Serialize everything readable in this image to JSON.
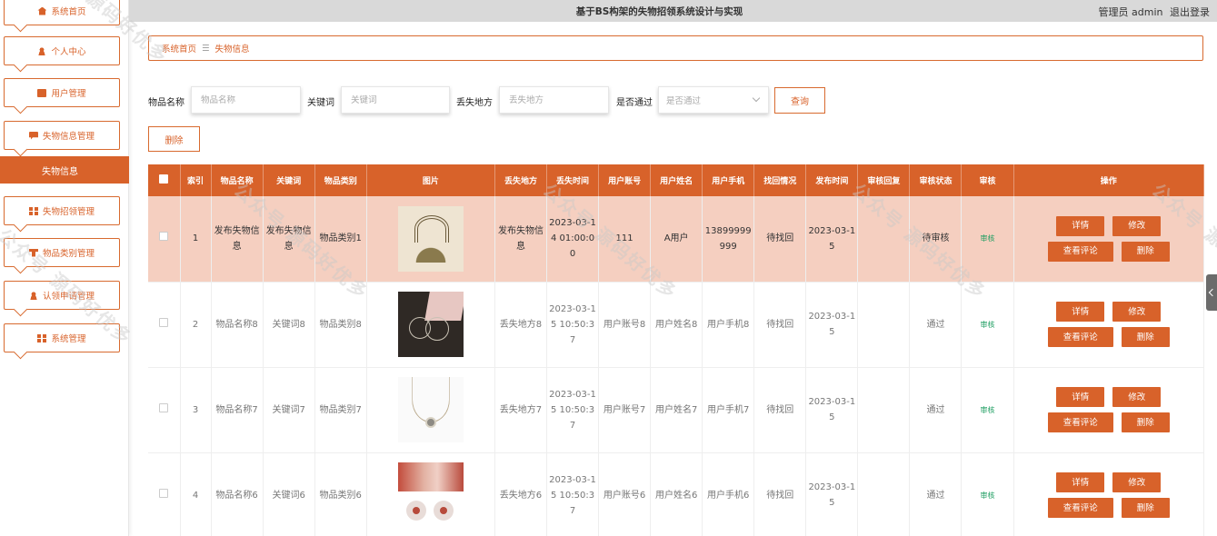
{
  "app": {
    "title": "基于BS构架的失物招领系统设计与实现",
    "user_label": "管理员 admin",
    "logout": "退出登录"
  },
  "sidebar": {
    "items": [
      {
        "label": "系统首页",
        "icon": "home-icon"
      },
      {
        "label": "个人中心",
        "icon": "user-icon"
      },
      {
        "label": "用户管理",
        "icon": "briefcase-icon"
      },
      {
        "label": "失物信息管理",
        "icon": "message-icon"
      },
      {
        "label": "失物招领管理",
        "icon": "grid-icon"
      },
      {
        "label": "物品类别管理",
        "icon": "shop-icon"
      },
      {
        "label": "认领申请管理",
        "icon": "user-icon"
      },
      {
        "label": "系统管理",
        "icon": "grid-icon"
      }
    ],
    "active_sub": "失物信息"
  },
  "breadcrumb": {
    "home": "系统首页",
    "sep": "☰",
    "current": "失物信息"
  },
  "search": {
    "name_label": "物品名称",
    "name_placeholder": "物品名称",
    "keyword_label": "关键词",
    "keyword_placeholder": "关键词",
    "place_label": "丢失地方",
    "place_placeholder": "丢失地方",
    "passed_label": "是否通过",
    "passed_placeholder": "是否通过",
    "query_btn": "查询",
    "delete_btn": "删除"
  },
  "table": {
    "headers": [
      "索引",
      "物品名称",
      "关键词",
      "物品类别",
      "图片",
      "丢失地方",
      "丢失时间",
      "用户账号",
      "用户姓名",
      "用户手机",
      "找回情况",
      "发布时间",
      "审核回复",
      "审核状态",
      "审核",
      "操作"
    ],
    "rows": [
      {
        "index": "1",
        "name": "发布失物信息",
        "keyword": "发布失物信息",
        "category": "物品类别1",
        "image": "book",
        "place": "发布失物信息",
        "time": "2023-03-14 01:00:00",
        "account": "111",
        "username": "A用户",
        "phone": "13899999999",
        "found": "待找回",
        "publish": "2023-03-15",
        "reply": "",
        "status": "待审核",
        "audit": "审核"
      },
      {
        "index": "2",
        "name": "物品名称8",
        "keyword": "关键词8",
        "category": "物品类别8",
        "image": "rings",
        "place": "丢失地方8",
        "time": "2023-03-15 10:50:37",
        "account": "用户账号8",
        "username": "用户姓名8",
        "phone": "用户手机8",
        "found": "待找回",
        "publish": "2023-03-15",
        "reply": "",
        "status": "通过",
        "audit": "审核"
      },
      {
        "index": "3",
        "name": "物品名称7",
        "keyword": "关键词7",
        "category": "物品类别7",
        "image": "necklace",
        "place": "丢失地方7",
        "time": "2023-03-15 10:50:37",
        "account": "用户账号7",
        "username": "用户姓名7",
        "phone": "用户手机7",
        "found": "待找回",
        "publish": "2023-03-15",
        "reply": "",
        "status": "通过",
        "audit": "审核"
      },
      {
        "index": "4",
        "name": "物品名称6",
        "keyword": "关键词6",
        "category": "物品类别6",
        "image": "earring",
        "place": "丢失地方6",
        "time": "2023-03-15 10:50:37",
        "account": "用户账号6",
        "username": "用户姓名6",
        "phone": "用户手机6",
        "found": "待找回",
        "publish": "2023-03-15",
        "reply": "",
        "status": "通过",
        "audit": "审核"
      }
    ],
    "ops": {
      "detail": "详情",
      "edit": "修改",
      "comments": "查看评论",
      "delete": "删除"
    }
  },
  "watermark": "公众号 源码好优多",
  "colors": {
    "accent": "#d8622a",
    "highlight_row": "#f5cfc0",
    "audit_green": "#1e9e61"
  }
}
